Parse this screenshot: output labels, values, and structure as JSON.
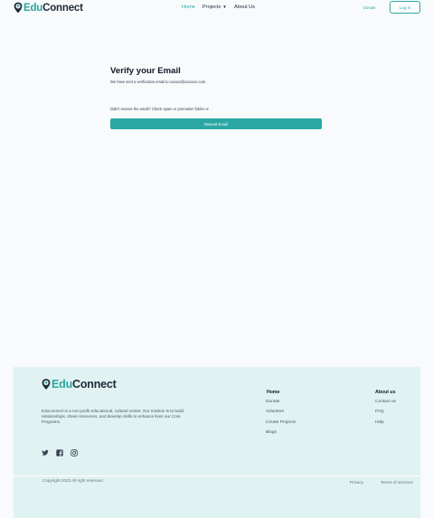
{
  "header": {
    "brand_edu": "Edu",
    "brand_connect": "Connect",
    "nav": {
      "home": "Home",
      "projects": "Projects",
      "about": "About Us"
    },
    "donate": "Donate",
    "login": "Log In"
  },
  "verify": {
    "title": "Verify your Email",
    "sent_text": "We have sent a verification email to xxxxxx@xxxxxxx.com.",
    "not_received": "Didn't receive the email? Check spam or promotion folder or",
    "resend_label": "Resend Email"
  },
  "footer": {
    "brand_edu": "Edu",
    "brand_connect": "Connect",
    "description": "Educonnect is a  non-profit educational, cultural center. Our mission is to build relationships, share resources, and develop skills to enhance lives  our Core Programs.",
    "col1": {
      "heading": "Home",
      "links": [
        "Donate",
        "Volunteer",
        "Create Projects",
        "Blogs"
      ]
    },
    "col2": {
      "heading": "About us",
      "links": [
        "Contact us",
        "FAQ",
        "Help"
      ]
    },
    "social_icons": [
      "twitter-icon",
      "facebook-icon",
      "instagram-icon"
    ],
    "copyright": "Copyright 2023 All right reserved",
    "privacy": "Privacy",
    "terms": "Terms of services"
  },
  "colors": {
    "accent": "#2aa7a3",
    "footer_bg": "#e0f2f1",
    "page_bg": "#f8fafc"
  }
}
